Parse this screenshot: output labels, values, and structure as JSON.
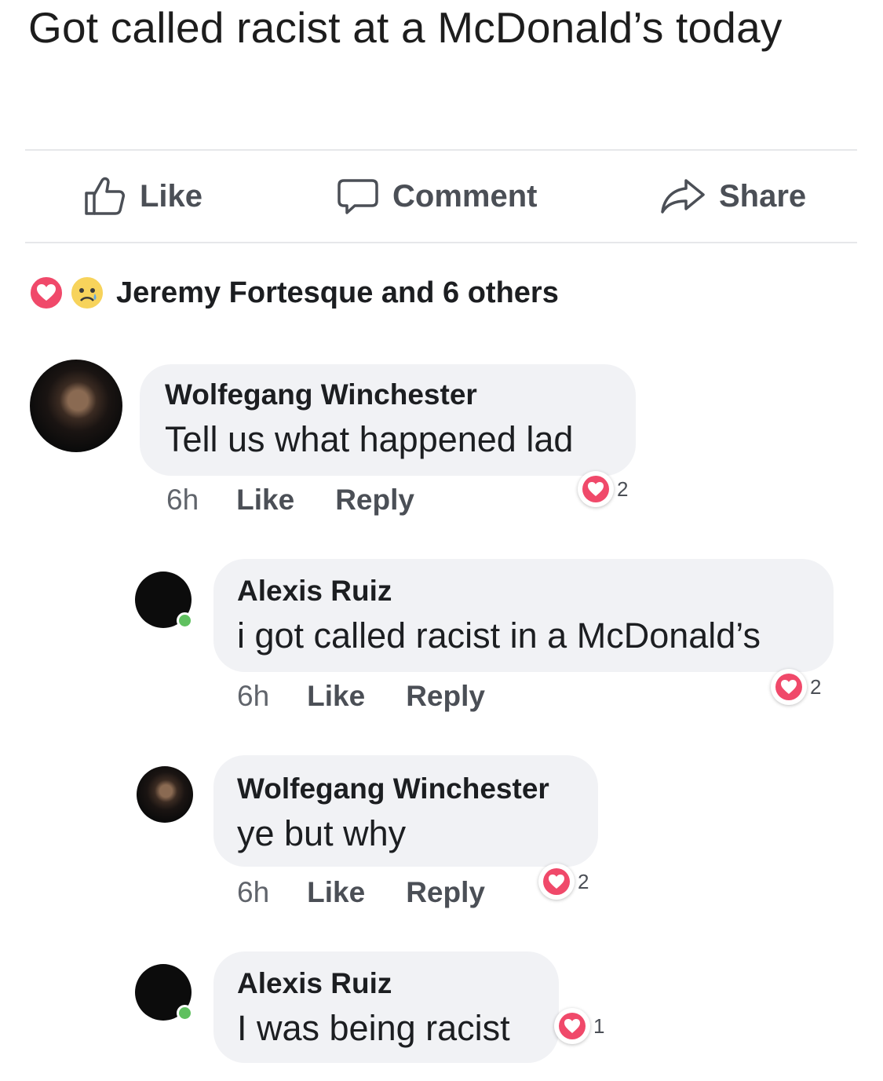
{
  "post": {
    "text": "Got called racist at a McDonald’s today"
  },
  "actions": {
    "like_label": "Like",
    "comment_label": "Comment",
    "share_label": "Share"
  },
  "reactions_summary": {
    "names": "Jeremy Fortesque and 6 others",
    "icons": [
      "heart-reaction-icon",
      "sad-reaction-icon"
    ]
  },
  "comments": [
    {
      "author": "Wolfegang Winchester",
      "text": "Tell us what happened lad",
      "time": "6h",
      "like_label": "Like",
      "reply_label": "Reply",
      "reaction_count": "2"
    },
    {
      "author": "Alexis Ruiz",
      "text": "i got called racist in a McDonald’s",
      "time": "6h",
      "like_label": "Like",
      "reply_label": "Reply",
      "reaction_count": "2"
    },
    {
      "author": "Wolfegang Winchester",
      "text": "ye but why",
      "time": "6h",
      "like_label": "Like",
      "reply_label": "Reply",
      "reaction_count": "2"
    },
    {
      "author": "Alexis Ruiz",
      "text": "I was being racist",
      "reaction_count": "1"
    }
  ],
  "colors": {
    "bubble": "#f1f2f5",
    "heart": "#f0496a",
    "secondary_text": "#4b4f56",
    "online": "#5fc05f"
  }
}
